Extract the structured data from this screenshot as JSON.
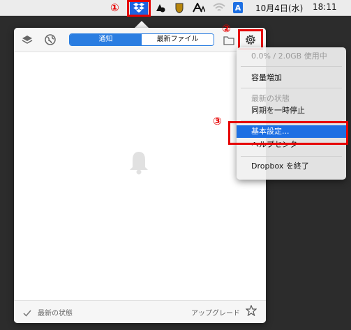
{
  "menubar": {
    "date": "10月4日(水)",
    "time": "18:11",
    "input_source": "A",
    "icons": [
      "dropbox-icon",
      "cloud-icon",
      "shield-icon",
      "a-app-icon",
      "wifi-icon",
      "input-source-icon"
    ]
  },
  "annotations": {
    "step1": "①",
    "step2": "②",
    "step3": "③",
    "color": "#e60000"
  },
  "panel": {
    "tabs": [
      {
        "label": "通知",
        "active": true
      },
      {
        "label": "最新ファイル",
        "active": false
      }
    ],
    "footer_status": "最新の状態",
    "upgrade_label": "アップグレード",
    "accent": "#2a7de1"
  },
  "menu": {
    "usage": "0.0% / 2.0GB 使用中",
    "add_space": "容量増加",
    "status": "最新の状態",
    "pause": "同期を一時停止",
    "preferences": "基本設定...",
    "help": "ヘルプセンター",
    "quit": "Dropbox を終了",
    "highlight": "#1d6fe3"
  }
}
